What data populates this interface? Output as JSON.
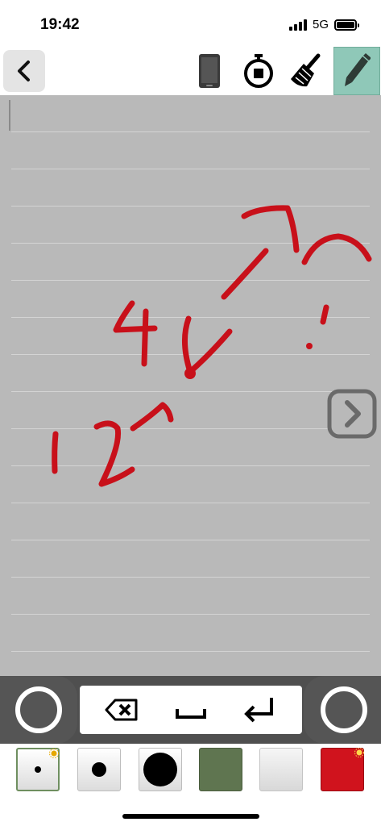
{
  "status_bar": {
    "time": "19:42",
    "network": "5G"
  },
  "toolbar": {
    "back_icon": "chevron-left-icon",
    "device_icon": "phone-icon",
    "timer_icon": "stopwatch-icon",
    "clear_icon": "broom-icon",
    "pen_icon": "pencil-icon"
  },
  "canvas": {
    "background": "#b9b9b9",
    "ink_color": "#c8101a"
  },
  "keyboard": {
    "backspace_icon": "backspace-icon",
    "space_icon": "space-icon",
    "enter_icon": "return-icon"
  },
  "palette": {
    "swatches": [
      {
        "kind": "pen-small",
        "selected": true
      },
      {
        "kind": "pen-medium"
      },
      {
        "kind": "pen-large"
      },
      {
        "kind": "color",
        "color": "#5f7550"
      },
      {
        "kind": "color",
        "color": "#e6e6e6"
      },
      {
        "kind": "color",
        "color": "#d0131d"
      }
    ]
  }
}
